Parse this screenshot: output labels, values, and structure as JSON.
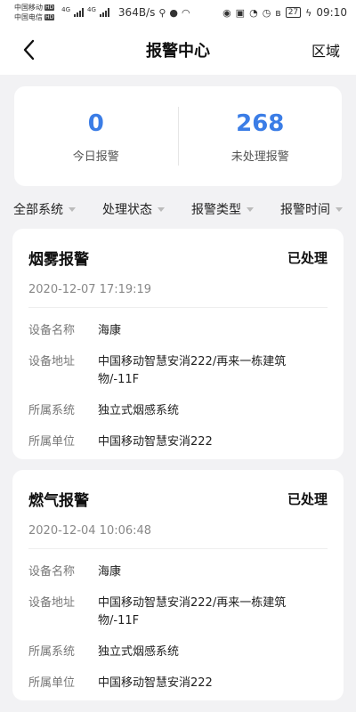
{
  "status_bar": {
    "carrier1": "中国移动",
    "carrier2": "中国电信",
    "hd_badge": "HD",
    "net_type1": "4G",
    "net_type2": "4G",
    "speed": "364B/s",
    "battery": "27",
    "time": "09:10"
  },
  "header": {
    "title": "报警中心",
    "area_label": "区域"
  },
  "summary": {
    "today_count": "0",
    "today_label": "今日报警",
    "unhandled_count": "268",
    "unhandled_label": "未处理报警"
  },
  "filters": [
    {
      "label": "全部系统"
    },
    {
      "label": "处理状态"
    },
    {
      "label": "报警类型"
    },
    {
      "label": "报警时间"
    }
  ],
  "alarms": [
    {
      "type": "烟雾报警",
      "status": "已处理",
      "time": "2020-12-07 17:19:19",
      "fields": [
        {
          "label": "设备名称",
          "value": "海康"
        },
        {
          "label": "设备地址",
          "value": "中国移动智慧安消222/再来一栋建筑物/-11F"
        },
        {
          "label": "所属系统",
          "value": "独立式烟感系统"
        },
        {
          "label": "所属单位",
          "value": "中国移动智慧安消222"
        }
      ]
    },
    {
      "type": "燃气报警",
      "status": "已处理",
      "time": "2020-12-04 10:06:48",
      "fields": [
        {
          "label": "设备名称",
          "value": "海康"
        },
        {
          "label": "设备地址",
          "value": "中国移动智慧安消222/再来一栋建筑物/-11F"
        },
        {
          "label": "所属系统",
          "value": "独立式烟感系统"
        },
        {
          "label": "所属单位",
          "value": "中国移动智慧安消222"
        }
      ]
    }
  ],
  "colors": {
    "accent": "#3b7de6",
    "background": "#f2f2f4"
  }
}
